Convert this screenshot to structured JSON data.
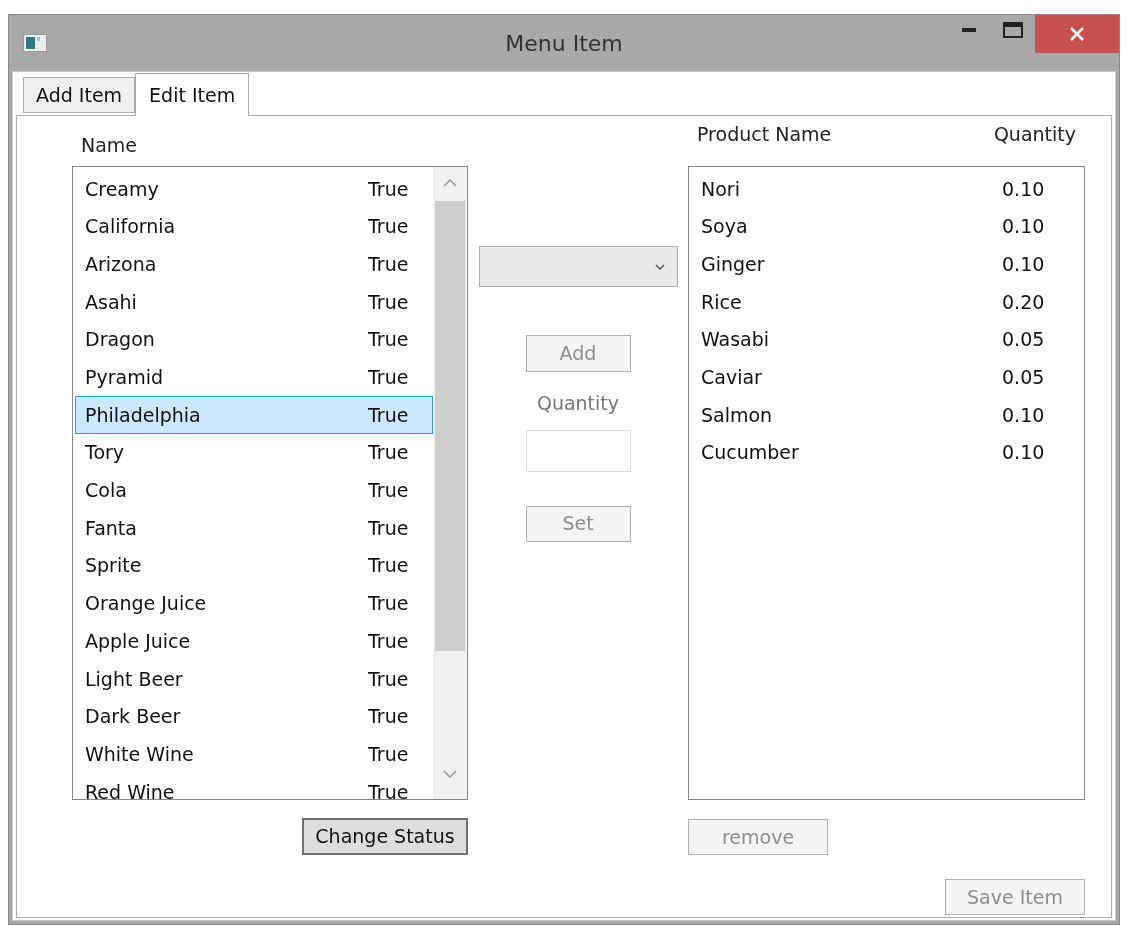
{
  "window": {
    "title": "Menu Item"
  },
  "tabs": [
    {
      "label": "Add Item",
      "selected": false
    },
    {
      "label": "Edit Item",
      "selected": true
    }
  ],
  "items_list": {
    "column_header": "Name",
    "rows": [
      {
        "name": "Creamy",
        "status": "True",
        "selected": false
      },
      {
        "name": "California",
        "status": "True",
        "selected": false
      },
      {
        "name": "Arizona",
        "status": "True",
        "selected": false
      },
      {
        "name": "Asahi",
        "status": "True",
        "selected": false
      },
      {
        "name": "Dragon",
        "status": "True",
        "selected": false
      },
      {
        "name": "Pyramid",
        "status": "True",
        "selected": false
      },
      {
        "name": "Philadelphia",
        "status": "True",
        "selected": true
      },
      {
        "name": "Tory",
        "status": "True",
        "selected": false
      },
      {
        "name": "Cola",
        "status": "True",
        "selected": false
      },
      {
        "name": "Fanta",
        "status": "True",
        "selected": false
      },
      {
        "name": "Sprite",
        "status": "True",
        "selected": false
      },
      {
        "name": "Orange Juice",
        "status": "True",
        "selected": false
      },
      {
        "name": "Apple Juice",
        "status": "True",
        "selected": false
      },
      {
        "name": "Light Beer",
        "status": "True",
        "selected": false
      },
      {
        "name": "Dark Beer",
        "status": "True",
        "selected": false
      },
      {
        "name": "White Wine",
        "status": "True",
        "selected": false
      },
      {
        "name": "Red Wine",
        "status": "True",
        "selected": false
      }
    ]
  },
  "change_status_button": {
    "label": "Change Status",
    "disabled": false
  },
  "middle": {
    "add_button": {
      "label": "Add",
      "disabled": true
    },
    "quantity_label": "Quantity",
    "set_button": {
      "label": "Set",
      "disabled": true
    }
  },
  "ingredients": {
    "columns": [
      "Product Name",
      "Quantity"
    ],
    "rows": [
      {
        "product": "Nori",
        "quantity": "0.10"
      },
      {
        "product": "Soya",
        "quantity": "0.10"
      },
      {
        "product": "Ginger",
        "quantity": "0.10"
      },
      {
        "product": "Rice",
        "quantity": "0.20"
      },
      {
        "product": "Wasabi",
        "quantity": "0.05"
      },
      {
        "product": "Caviar",
        "quantity": "0.05"
      },
      {
        "product": "Salmon",
        "quantity": "0.10"
      },
      {
        "product": "Cucumber",
        "quantity": "0.10"
      }
    ]
  },
  "remove_button": {
    "label": "remove",
    "disabled": true
  },
  "save_button": {
    "label": "Save Item",
    "disabled": true
  }
}
